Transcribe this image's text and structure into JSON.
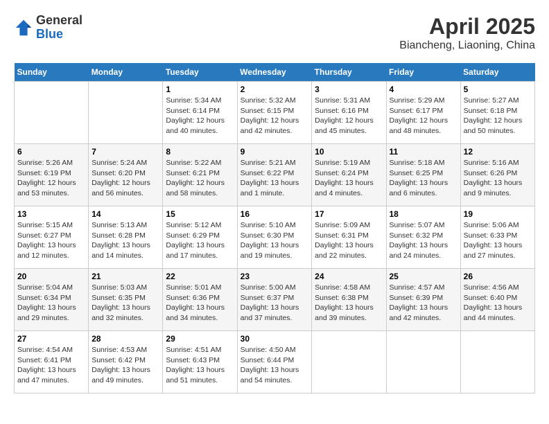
{
  "header": {
    "logo": {
      "general": "General",
      "blue": "Blue"
    },
    "title": "April 2025",
    "subtitle": "Biancheng, Liaoning, China"
  },
  "days_of_week": [
    "Sunday",
    "Monday",
    "Tuesday",
    "Wednesday",
    "Thursday",
    "Friday",
    "Saturday"
  ],
  "weeks": [
    [
      {
        "day": "",
        "info": ""
      },
      {
        "day": "",
        "info": ""
      },
      {
        "day": "1",
        "info": "Sunrise: 5:34 AM\nSunset: 6:14 PM\nDaylight: 12 hours and 40 minutes."
      },
      {
        "day": "2",
        "info": "Sunrise: 5:32 AM\nSunset: 6:15 PM\nDaylight: 12 hours and 42 minutes."
      },
      {
        "day": "3",
        "info": "Sunrise: 5:31 AM\nSunset: 6:16 PM\nDaylight: 12 hours and 45 minutes."
      },
      {
        "day": "4",
        "info": "Sunrise: 5:29 AM\nSunset: 6:17 PM\nDaylight: 12 hours and 48 minutes."
      },
      {
        "day": "5",
        "info": "Sunrise: 5:27 AM\nSunset: 6:18 PM\nDaylight: 12 hours and 50 minutes."
      }
    ],
    [
      {
        "day": "6",
        "info": "Sunrise: 5:26 AM\nSunset: 6:19 PM\nDaylight: 12 hours and 53 minutes."
      },
      {
        "day": "7",
        "info": "Sunrise: 5:24 AM\nSunset: 6:20 PM\nDaylight: 12 hours and 56 minutes."
      },
      {
        "day": "8",
        "info": "Sunrise: 5:22 AM\nSunset: 6:21 PM\nDaylight: 12 hours and 58 minutes."
      },
      {
        "day": "9",
        "info": "Sunrise: 5:21 AM\nSunset: 6:22 PM\nDaylight: 13 hours and 1 minute."
      },
      {
        "day": "10",
        "info": "Sunrise: 5:19 AM\nSunset: 6:24 PM\nDaylight: 13 hours and 4 minutes."
      },
      {
        "day": "11",
        "info": "Sunrise: 5:18 AM\nSunset: 6:25 PM\nDaylight: 13 hours and 6 minutes."
      },
      {
        "day": "12",
        "info": "Sunrise: 5:16 AM\nSunset: 6:26 PM\nDaylight: 13 hours and 9 minutes."
      }
    ],
    [
      {
        "day": "13",
        "info": "Sunrise: 5:15 AM\nSunset: 6:27 PM\nDaylight: 13 hours and 12 minutes."
      },
      {
        "day": "14",
        "info": "Sunrise: 5:13 AM\nSunset: 6:28 PM\nDaylight: 13 hours and 14 minutes."
      },
      {
        "day": "15",
        "info": "Sunrise: 5:12 AM\nSunset: 6:29 PM\nDaylight: 13 hours and 17 minutes."
      },
      {
        "day": "16",
        "info": "Sunrise: 5:10 AM\nSunset: 6:30 PM\nDaylight: 13 hours and 19 minutes."
      },
      {
        "day": "17",
        "info": "Sunrise: 5:09 AM\nSunset: 6:31 PM\nDaylight: 13 hours and 22 minutes."
      },
      {
        "day": "18",
        "info": "Sunrise: 5:07 AM\nSunset: 6:32 PM\nDaylight: 13 hours and 24 minutes."
      },
      {
        "day": "19",
        "info": "Sunrise: 5:06 AM\nSunset: 6:33 PM\nDaylight: 13 hours and 27 minutes."
      }
    ],
    [
      {
        "day": "20",
        "info": "Sunrise: 5:04 AM\nSunset: 6:34 PM\nDaylight: 13 hours and 29 minutes."
      },
      {
        "day": "21",
        "info": "Sunrise: 5:03 AM\nSunset: 6:35 PM\nDaylight: 13 hours and 32 minutes."
      },
      {
        "day": "22",
        "info": "Sunrise: 5:01 AM\nSunset: 6:36 PM\nDaylight: 13 hours and 34 minutes."
      },
      {
        "day": "23",
        "info": "Sunrise: 5:00 AM\nSunset: 6:37 PM\nDaylight: 13 hours and 37 minutes."
      },
      {
        "day": "24",
        "info": "Sunrise: 4:58 AM\nSunset: 6:38 PM\nDaylight: 13 hours and 39 minutes."
      },
      {
        "day": "25",
        "info": "Sunrise: 4:57 AM\nSunset: 6:39 PM\nDaylight: 13 hours and 42 minutes."
      },
      {
        "day": "26",
        "info": "Sunrise: 4:56 AM\nSunset: 6:40 PM\nDaylight: 13 hours and 44 minutes."
      }
    ],
    [
      {
        "day": "27",
        "info": "Sunrise: 4:54 AM\nSunset: 6:41 PM\nDaylight: 13 hours and 47 minutes."
      },
      {
        "day": "28",
        "info": "Sunrise: 4:53 AM\nSunset: 6:42 PM\nDaylight: 13 hours and 49 minutes."
      },
      {
        "day": "29",
        "info": "Sunrise: 4:51 AM\nSunset: 6:43 PM\nDaylight: 13 hours and 51 minutes."
      },
      {
        "day": "30",
        "info": "Sunrise: 4:50 AM\nSunset: 6:44 PM\nDaylight: 13 hours and 54 minutes."
      },
      {
        "day": "",
        "info": ""
      },
      {
        "day": "",
        "info": ""
      },
      {
        "day": "",
        "info": ""
      }
    ]
  ]
}
